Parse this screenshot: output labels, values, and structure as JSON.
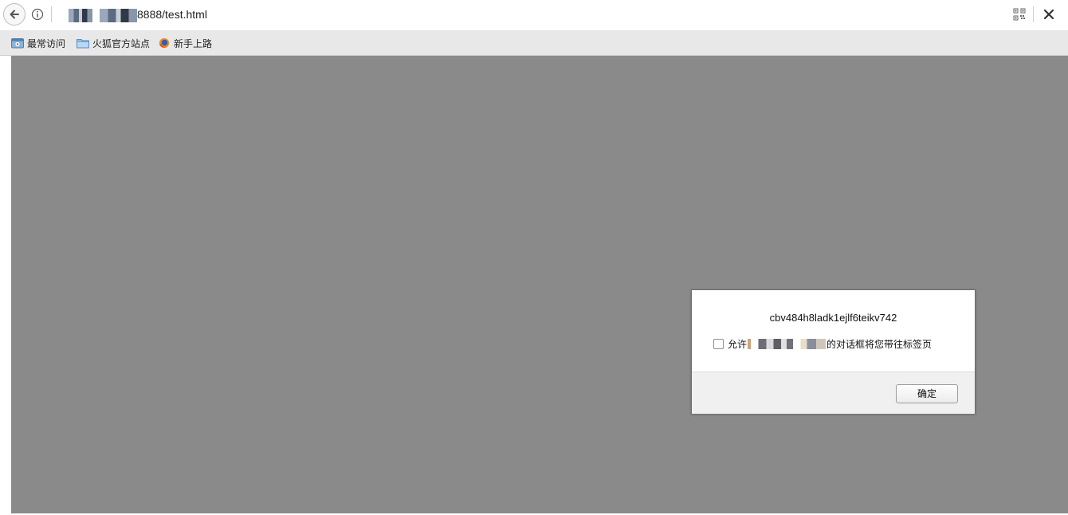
{
  "toolbar": {
    "url_suffix": "8888/test.html",
    "icons": {
      "back": "back-arrow-icon",
      "info": "info-icon",
      "qr": "qr-code-icon",
      "close": "close-icon"
    }
  },
  "bookmarks": {
    "items": [
      {
        "label": "最常访问",
        "icon": "most-visited-icon"
      },
      {
        "label": "火狐官方站点",
        "icon": "folder-icon"
      },
      {
        "label": "新手上路",
        "icon": "firefox-icon"
      }
    ]
  },
  "dialog": {
    "message": "cbv484h8ladk1ejlf6teikv742",
    "checkbox_prefix": "允许",
    "checkbox_suffix": "的对话框将您带往标签页",
    "ok_label": "确定"
  },
  "colors": {
    "overlay": "#8a8a8a",
    "toolbar_bg": "#ffffff",
    "bookmarks_bg": "#e8e8e8",
    "dialog_footer": "#f0f0f0"
  }
}
